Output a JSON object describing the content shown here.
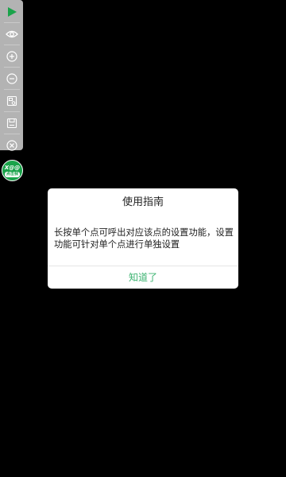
{
  "toolbar": {
    "items": [
      {
        "icon": "play-icon"
      },
      {
        "icon": "eye-icon"
      },
      {
        "icon": "zoom-in-icon"
      },
      {
        "icon": "zoom-out-icon"
      },
      {
        "icon": "image-settings-icon"
      },
      {
        "icon": "save-icon"
      },
      {
        "icon": "close-icon"
      }
    ],
    "accent_color": "#1aa34a"
  },
  "badge": {
    "top_text": "X@@",
    "bottom_text": "点击我"
  },
  "dialog": {
    "title": "使用指南",
    "message": "长按单个点可呼出对应该点的设置功能，设置功能可针对单个点进行单独设置",
    "confirm_label": "知道了",
    "confirm_color": "#3cb371"
  }
}
